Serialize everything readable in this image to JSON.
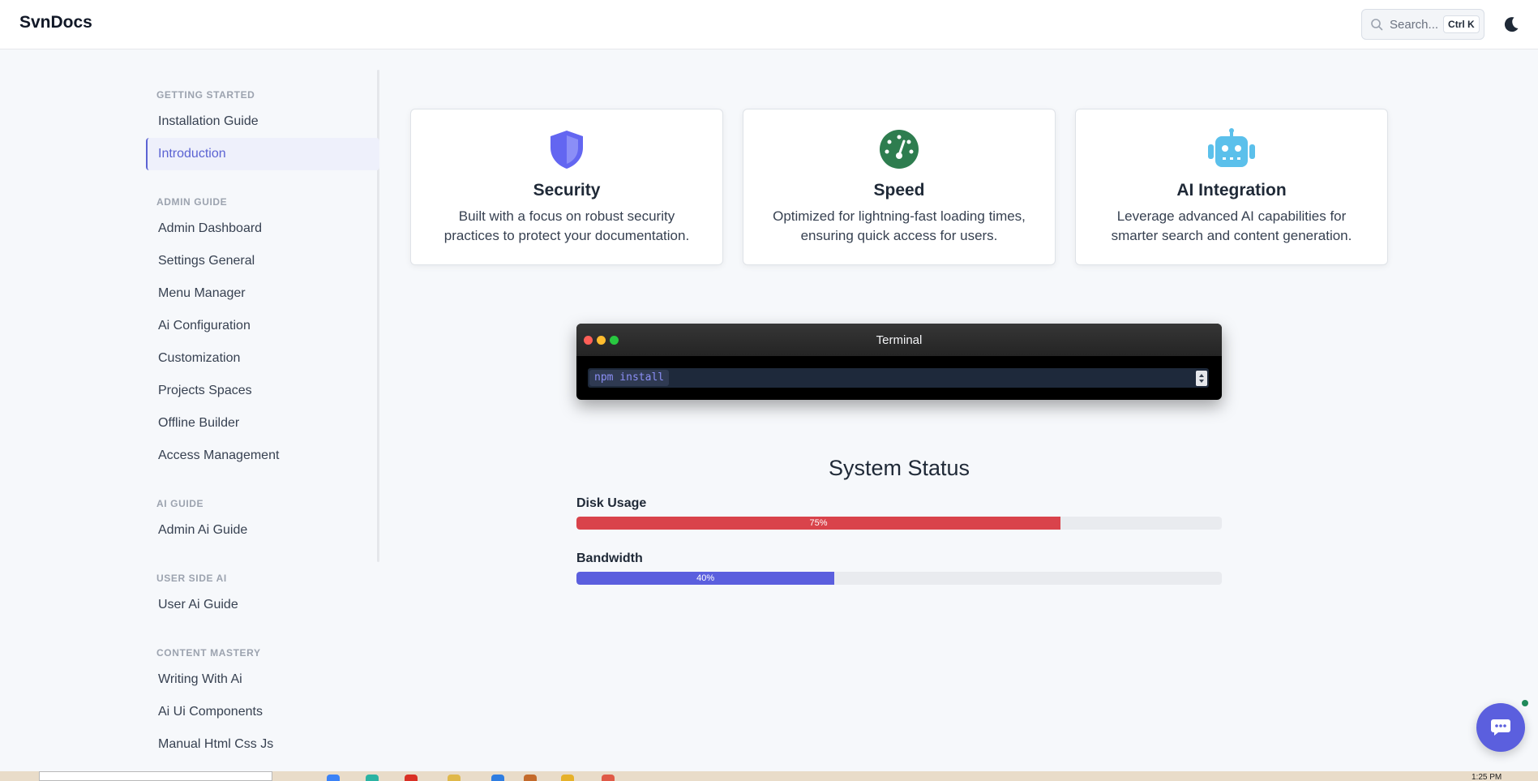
{
  "header": {
    "brand": "SvnDocs",
    "search_placeholder": "Search...",
    "search_shortcut": "Ctrl K"
  },
  "sidebar": {
    "sections": [
      {
        "title": "GETTING STARTED",
        "items": [
          "Installation Guide",
          "Introduction"
        ]
      },
      {
        "title": "ADMIN GUIDE",
        "items": [
          "Admin Dashboard",
          "Settings General",
          "Menu Manager",
          "Ai Configuration",
          "Customization",
          "Projects Spaces",
          "Offline Builder",
          "Access Management"
        ]
      },
      {
        "title": "AI GUIDE",
        "items": [
          "Admin Ai Guide"
        ]
      },
      {
        "title": "USER SIDE AI",
        "items": [
          "User Ai Guide"
        ]
      },
      {
        "title": "CONTENT MASTERY",
        "items": [
          "Writing With Ai",
          "Ai Ui Components",
          "Manual Html Css Js"
        ]
      }
    ],
    "active_item": "Introduction"
  },
  "features": [
    {
      "icon": "shield-icon",
      "title": "Security",
      "description": "Built with a focus on robust security practices to protect your documentation.",
      "color": "#6366f1"
    },
    {
      "icon": "speedometer-icon",
      "title": "Speed",
      "description": "Optimized for lightning-fast loading times, ensuring quick access for users.",
      "color": "#2e7d4f"
    },
    {
      "icon": "robot-icon",
      "title": "AI Integration",
      "description": "Leverage advanced AI capabilities for smarter search and content generation.",
      "color": "#5bc0eb"
    }
  ],
  "terminal": {
    "title": "Terminal",
    "command": "npm install"
  },
  "status": {
    "title": "System Status",
    "bars": [
      {
        "label": "Disk Usage",
        "value": 75,
        "value_label": "75%",
        "color": "#d9434b"
      },
      {
        "label": "Bandwidth",
        "value": 40,
        "value_label": "40%",
        "color": "#5b5fde"
      }
    ]
  },
  "taskbar": {
    "clock": "1:25 PM"
  }
}
